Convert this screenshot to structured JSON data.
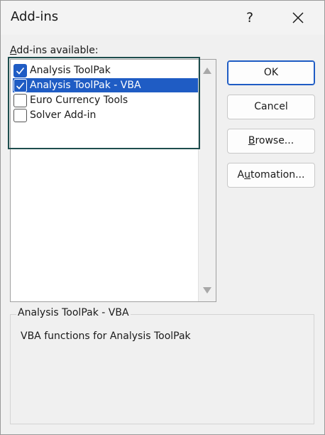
{
  "dialog": {
    "title": "Add-ins",
    "help_label": "?"
  },
  "list": {
    "label_accel": "A",
    "label_rest": "dd-ins available:",
    "items": [
      {
        "label": "Analysis ToolPak",
        "checked": true,
        "selected": false
      },
      {
        "label": "Analysis ToolPak - VBA",
        "checked": true,
        "selected": true
      },
      {
        "label": "Euro Currency Tools",
        "checked": false,
        "selected": false
      },
      {
        "label": "Solver Add-in",
        "checked": false,
        "selected": false
      }
    ]
  },
  "buttons": {
    "ok": "OK",
    "cancel": "Cancel",
    "browse_accel": "B",
    "browse_rest": "rowse...",
    "automation_pre": "A",
    "automation_accel": "u",
    "automation_rest": "tomation..."
  },
  "description": {
    "title": "Analysis ToolPak - VBA",
    "text": "VBA functions for Analysis ToolPak"
  },
  "colors": {
    "accent": "#1f5cc4",
    "focus_frame": "#1e4e4e"
  }
}
